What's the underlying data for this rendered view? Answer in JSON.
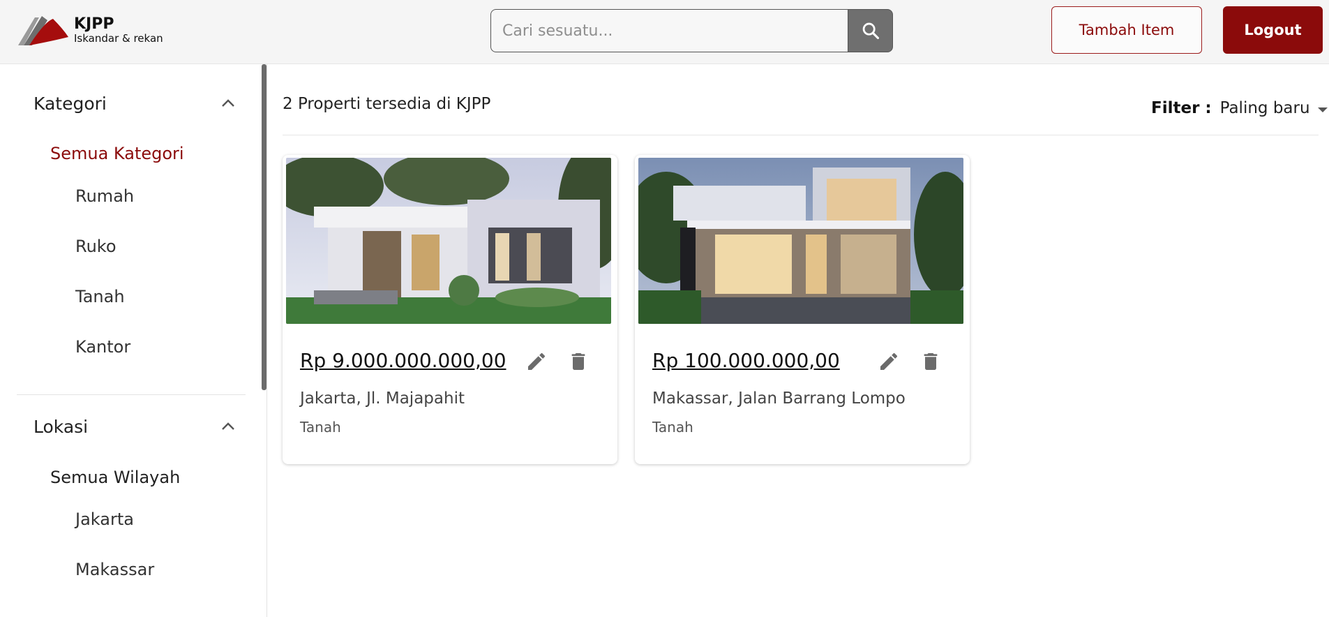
{
  "header": {
    "logo_title": "KJPP",
    "logo_subtitle": "Iskandar & rekan",
    "search_placeholder": "Cari sesuatu...",
    "add_button": "Tambah Item",
    "logout_button": "Logout"
  },
  "sidebar": {
    "kategori": {
      "title": "Kategori",
      "all": "Semua Kategori",
      "items": [
        "Rumah",
        "Ruko",
        "Tanah",
        "Kantor"
      ]
    },
    "lokasi": {
      "title": "Lokasi",
      "all": "Semua Wilayah",
      "items": [
        "Jakarta",
        "Makassar"
      ]
    }
  },
  "main": {
    "title": "2 Properti tersedia di KJPP",
    "filter_label": "Filter :",
    "filter_value": "Paling baru",
    "cards": [
      {
        "price": "Rp 9.000.000.000,00",
        "location": "Jakarta, Jl. Majapahit",
        "category": "Tanah"
      },
      {
        "price": "Rp 100.000.000,00",
        "location": "Makassar, Jalan Barrang Lompo",
        "category": "Tanah"
      }
    ]
  },
  "colors": {
    "brand": "#8b0b0b",
    "active_text": "#8b0b0b",
    "header_bg": "#f5f5f5",
    "search_button": "#6f6f6f",
    "icon_gray": "#6b6b6b"
  },
  "icons": {
    "logo": "kjpp-logo-icon",
    "search": "search-icon",
    "chevron": "chevron-up-icon",
    "caret": "caret-down-icon",
    "edit": "pencil-icon",
    "delete": "trash-icon"
  }
}
